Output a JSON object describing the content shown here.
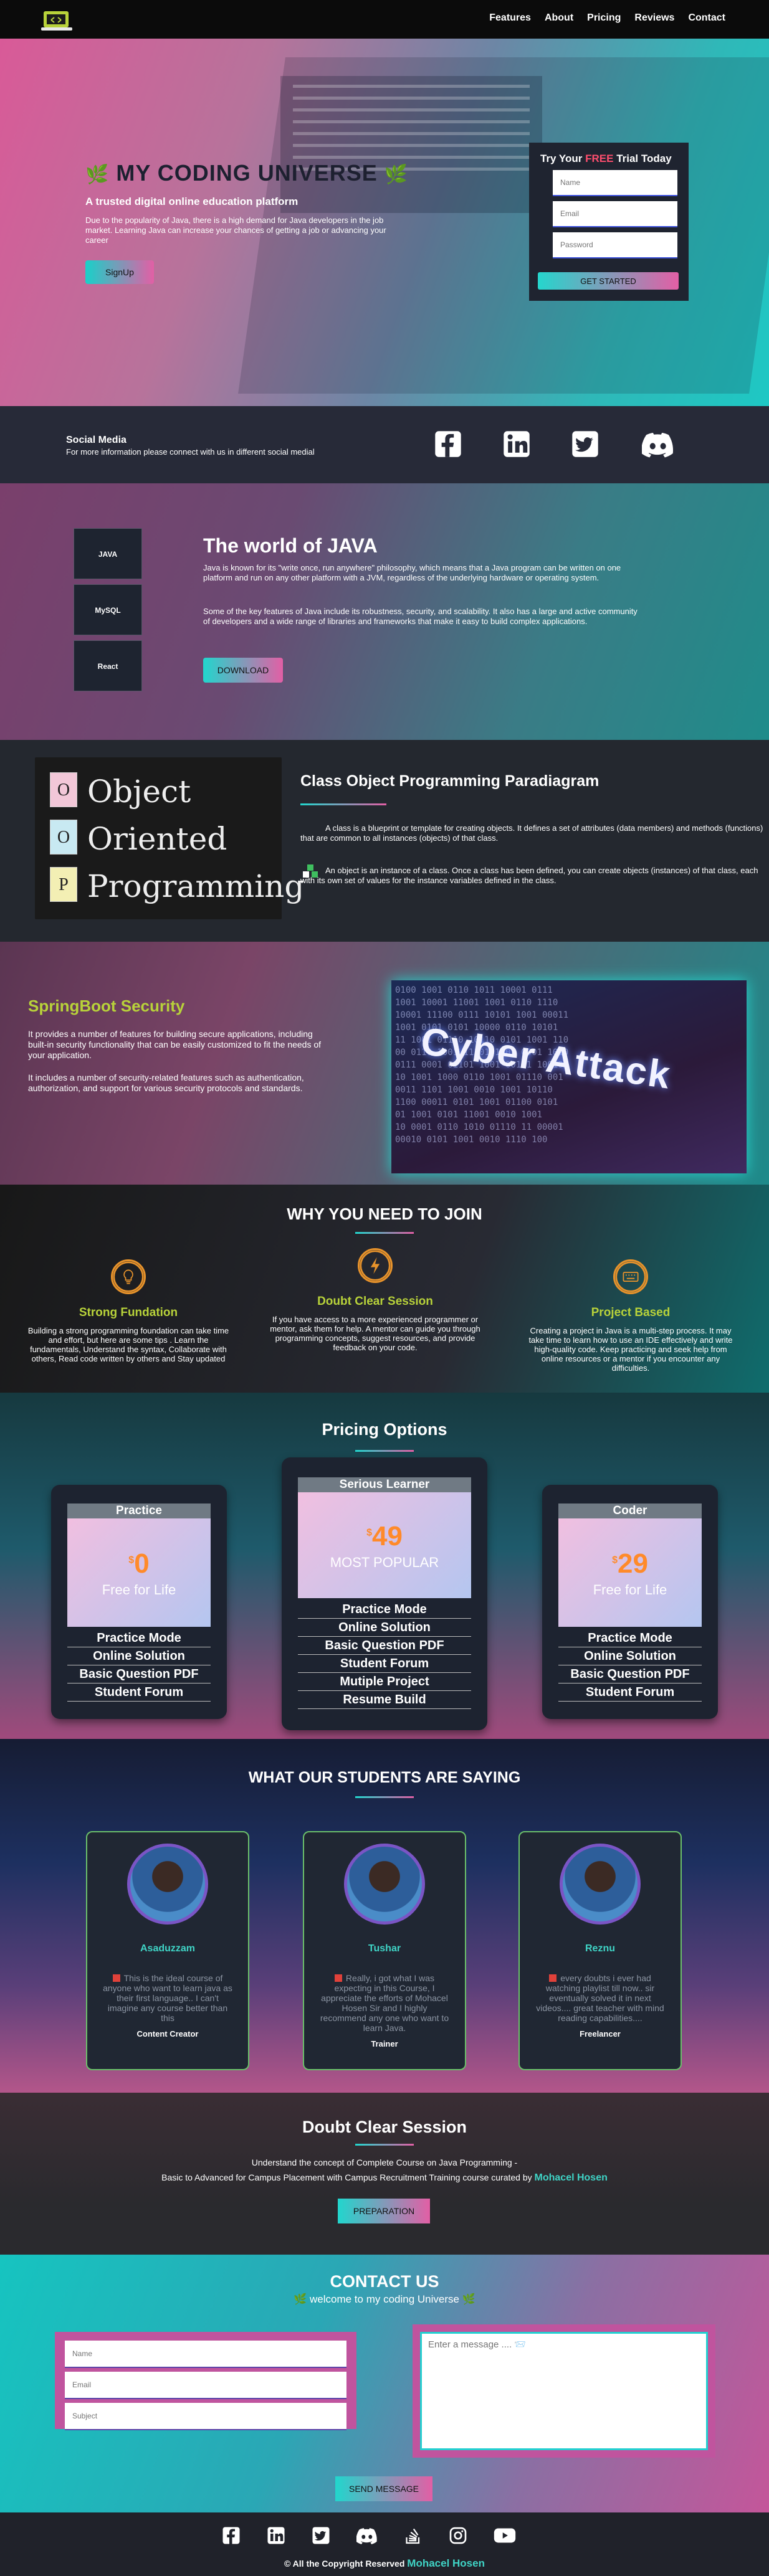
{
  "nav": {
    "logo_icon": "laptop-logo-icon",
    "links": [
      "Features",
      "About",
      "Pricing",
      "Reviews",
      "Contact"
    ]
  },
  "hero": {
    "title": "MY CODING UNIVERSE",
    "tagline": "A trusted digital online education platform",
    "description": "Due to the popularity of Java, there is a high demand for Java developers in the job market. Learning Java can increase your chances of getting a job or advancing your career",
    "signup_label": "SignUp",
    "trial": {
      "title_before": "Try Your ",
      "title_highlight": "FREE",
      "title_after": " Trial Today",
      "name_placeholder": "Name",
      "email_placeholder": "Email",
      "password_placeholder": "Password",
      "button_label": "GET STARTED"
    }
  },
  "social": {
    "title": "Social Media",
    "text": "For more information please connect with us in different social medial",
    "icons": [
      "facebook-icon",
      "linkedin-icon",
      "twitter-icon",
      "discord-icon"
    ]
  },
  "java": {
    "stack": [
      "JAVA",
      "MySQL",
      "React"
    ],
    "title": "The world of JAVA",
    "p1": "Java is known for its \"write once, run anywhere\" philosophy, which means that a Java program can be written on one platform and run on any other platform with a JVM, regardless of the underlying hardware or operating system.",
    "p2": "Some of the key features of Java include its robustness, security, and scalability. It also has a large and active community of developers and a wide range of libraries and frameworks that make it easy to build complex applications.",
    "download_label": "DOWNLOAD"
  },
  "oop": {
    "board_letters": [
      "O",
      "O",
      "P"
    ],
    "board_words": [
      "Object",
      "Oriented",
      "Programming"
    ],
    "title": "Class Object Programming Paradiagram",
    "p1": "A class is a blueprint or template for creating objects. It defines a set of attributes (data members) and methods (functions) that are common to all instances (objects) of that class.",
    "p2": "An object is an instance of a class. Once a class has been defined, you can create objects (instances) of that class, each with its own set of values for the instance variables defined in the class."
  },
  "spring": {
    "title": "SpringBoot Security",
    "p1": "It provides a number of features for building secure applications, including built-in security functionality that can be easily customized to fit the needs of your application.",
    "p2": "It includes a number of security-related features such as authentication, authorization, and support for various security protocols and standards.",
    "image_text": "Cyber Attack",
    "binary_rows": [
      "0100 1001 0110 1011 10001 0111",
      "1001 10001 11001 1001 0110 1110",
      "10001 11100 0111 10101 1001 00011",
      "1001 0101 0101 10000 0110 10101",
      "11 1001 01110 10110 0101 1001 110",
      "00 0110 1001 11101 1001 0001 1010",
      "0111 0001 01101 1001 00111 10010",
      "10 1001 1000 0110 1001 01110 001",
      "0011 1101 1001 0010 1001 10110",
      "1100 00011 0101 1001 01100 0101",
      "01 1001 0101 11001 0010 1001",
      "10 0001 0110 1010 01110 11 00001",
      "00010 0101 1001 0010 1110 100"
    ]
  },
  "why": {
    "title": "WHY YOU NEED TO JOIN",
    "items": [
      {
        "icon": "lightbulb-icon",
        "title": "Strong Fundation",
        "text": "Building a strong programming foundation can take time and effort, but here are some tips . Learn the fundamentals, Understand the syntax, Collaborate with others, Read code written by others and Stay updated"
      },
      {
        "icon": "lightning-icon",
        "title": "Doubt Clear Session",
        "text": "If you have access to a more experienced programmer or mentor, ask them for help. A mentor can guide you through programming concepts, suggest resources, and provide feedback on your code."
      },
      {
        "icon": "keyboard-icon",
        "title": "Project Based",
        "text": "Creating a project in Java is a multi-step process. It may take time to learn how to use an IDE effectively and write high-quality code. Keep practicing and seek help from online resources or a mentor if you encounter any difficulties."
      }
    ]
  },
  "pricing": {
    "title": "Pricing Options",
    "plans": [
      {
        "name": "Practice",
        "currency": "$",
        "amount": "0",
        "label": "Free for Life",
        "features": [
          "Practice Mode",
          "Online Solution",
          "Basic Question PDF",
          "Student Forum"
        ]
      },
      {
        "name": "Serious Learner",
        "currency": "$",
        "amount": "49",
        "label": "MOST POPULAR",
        "features": [
          "Practice Mode",
          "Online Solution",
          "Basic Question PDF",
          "Student Forum",
          "Mutiple Project",
          "Resume Build"
        ]
      },
      {
        "name": "Coder",
        "currency": "$",
        "amount": "29",
        "label": "Free for Life",
        "features": [
          "Practice Mode",
          "Online Solution",
          "Basic Question PDF",
          "Student Forum"
        ]
      }
    ]
  },
  "testimonials": {
    "title": "WHAT OUR STUDENTS ARE SAYING",
    "items": [
      {
        "name": "Asaduzzam",
        "quote": "This is the ideal course of anyone who want to learn java as their first language.. I can't imagine any course better than this",
        "role": "Content Creator"
      },
      {
        "name": "Tushar",
        "quote": "Really, i got what I was expecting in this Course, I appreciate the efforts of Mohacel Hosen Sir and I highly recommend any one who want to learn Java.",
        "role": "Trainer"
      },
      {
        "name": "Reznu",
        "quote": "every doubts i ever had watching playlist till now.. sir eventually solved it in next videos.... great teacher with mind reading capabilities....",
        "role": "Freelancer"
      }
    ]
  },
  "doubt": {
    "title": "Doubt Clear Session",
    "line1": "Understand the concept of Complete Course on Java Programming -",
    "line2": "Basic to Advanced for Campus Placement with Campus Recruitment Training course curated by ",
    "author": "Mohacel Hosen",
    "button_label": "PREPARATION"
  },
  "contact": {
    "title": "CONTACT US",
    "welcome": "welcome to my coding Universe",
    "name_placeholder": "Name",
    "email_placeholder": "Email",
    "subject_placeholder": "Subject",
    "message_placeholder": "Enter a message .... 📨",
    "send_label": "SEND MESSAGE"
  },
  "footer": {
    "icons": [
      "facebook-icon",
      "linkedin-icon",
      "twitter-icon",
      "discord-icon",
      "stackoverflow-icon",
      "instagram-icon",
      "youtube-icon"
    ],
    "copyright": "© All the Copyright Reserved ",
    "author": "Mohacel Hosen"
  },
  "colors": {
    "accent_teal": "#21d6cd",
    "accent_pink": "#e25fa5",
    "lime": "#b8d23a",
    "orange": "#ff8a2a"
  }
}
